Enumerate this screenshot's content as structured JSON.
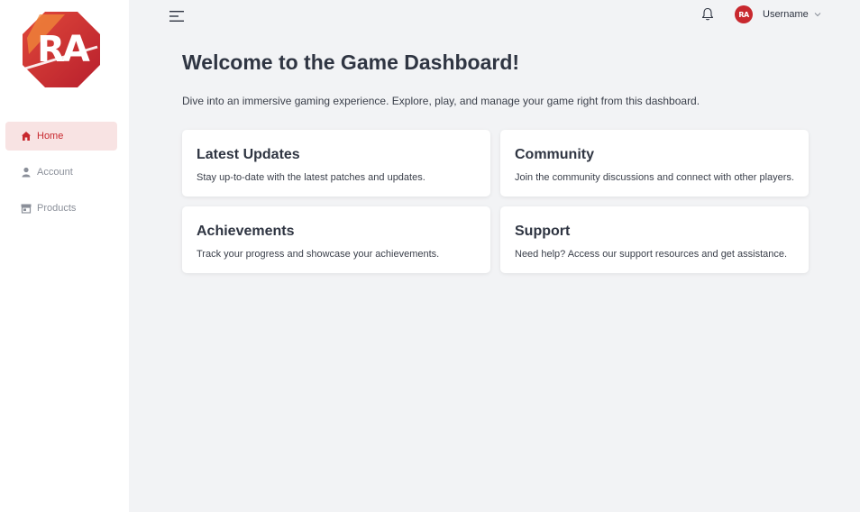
{
  "logo": {
    "text": "RA",
    "icon": "ra-logo",
    "color": "#c8282e"
  },
  "sidebar": {
    "items": [
      {
        "label": "Home",
        "icon": "home-icon",
        "active": true
      },
      {
        "label": "Account",
        "icon": "user-icon",
        "active": false
      },
      {
        "label": "Products",
        "icon": "store-icon",
        "active": false
      }
    ]
  },
  "header": {
    "menu_icon": "menu-icon",
    "bell_icon": "bell-icon",
    "avatar_text": "RA",
    "username": "Username",
    "chevron_icon": "chevron-down-icon"
  },
  "main": {
    "title": "Welcome to the Game Dashboard!",
    "subtitle": "Dive into an immersive gaming experience. Explore, play, and manage your game right from this dashboard.",
    "cards": [
      {
        "title": "Latest Updates",
        "text": "Stay up-to-date with the latest patches and updates."
      },
      {
        "title": "Community",
        "text": "Join the community discussions and connect with other players."
      },
      {
        "title": "Achievements",
        "text": "Track your progress and showcase your achievements."
      },
      {
        "title": "Support",
        "text": "Need help? Access our support resources and get assistance."
      }
    ]
  },
  "colors": {
    "accent": "#c8282e",
    "active_bg": "#f8e3e3",
    "background": "#f2f3f5"
  }
}
